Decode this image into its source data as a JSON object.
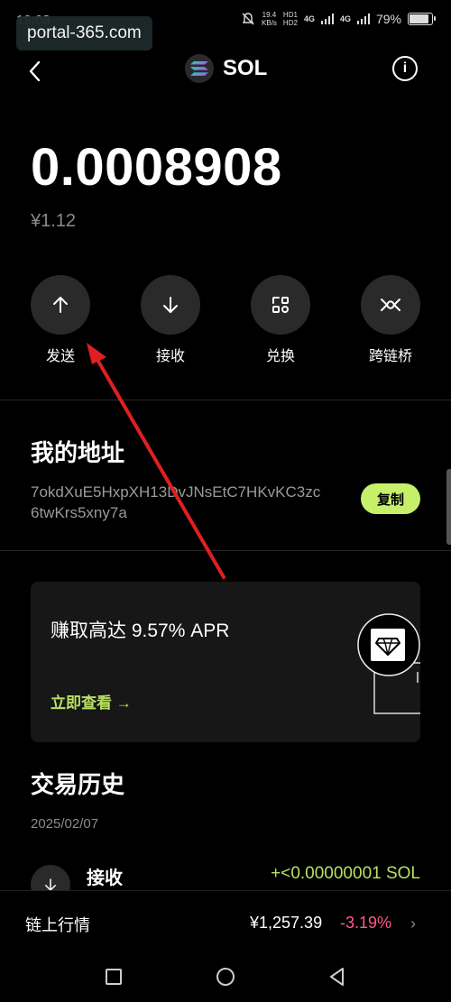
{
  "status_bar": {
    "time": "19:08",
    "net_speed_top": "19.4",
    "net_speed_bottom": "KB/s",
    "hd_top": "HD1",
    "hd_bottom": "HD2",
    "sig1": "4G",
    "sig2": "4G",
    "battery": "79%",
    "battery_level": 0.79
  },
  "url_badge": "portal-365.com",
  "header": {
    "title": "SOL",
    "back_icon": "chevron-left-icon",
    "info_icon": "info-icon"
  },
  "balance": {
    "amount": "0.0008908",
    "fiat": "¥1.12"
  },
  "actions": [
    {
      "label": "发送",
      "icon": "arrow-up-icon"
    },
    {
      "label": "接收",
      "icon": "arrow-down-icon"
    },
    {
      "label": "兑换",
      "icon": "swap-icon"
    },
    {
      "label": "跨链桥",
      "icon": "bridge-icon"
    }
  ],
  "address": {
    "title": "我的地址",
    "value": "7okdXuE5HxpXH13DvJNsEtC7HKvKC3zc6twKrs5xny7a",
    "copy_label": "复制"
  },
  "earn_card": {
    "title": "赚取高达 9.57% APR",
    "link": "立即查看 →"
  },
  "history": {
    "title": "交易历史",
    "date": "2025/02/07",
    "items": [
      {
        "label": "接收",
        "amount": "+<0.00000001 SOL",
        "icon": "arrow-down-icon"
      }
    ]
  },
  "market": {
    "label": "链上行情",
    "price": "¥1,257.39",
    "change": "-3.19%"
  },
  "colors": {
    "accent": "#c6f06a",
    "positive": "#b8e063",
    "negative": "#ff5a88",
    "annotation_arrow": "#e02020"
  }
}
